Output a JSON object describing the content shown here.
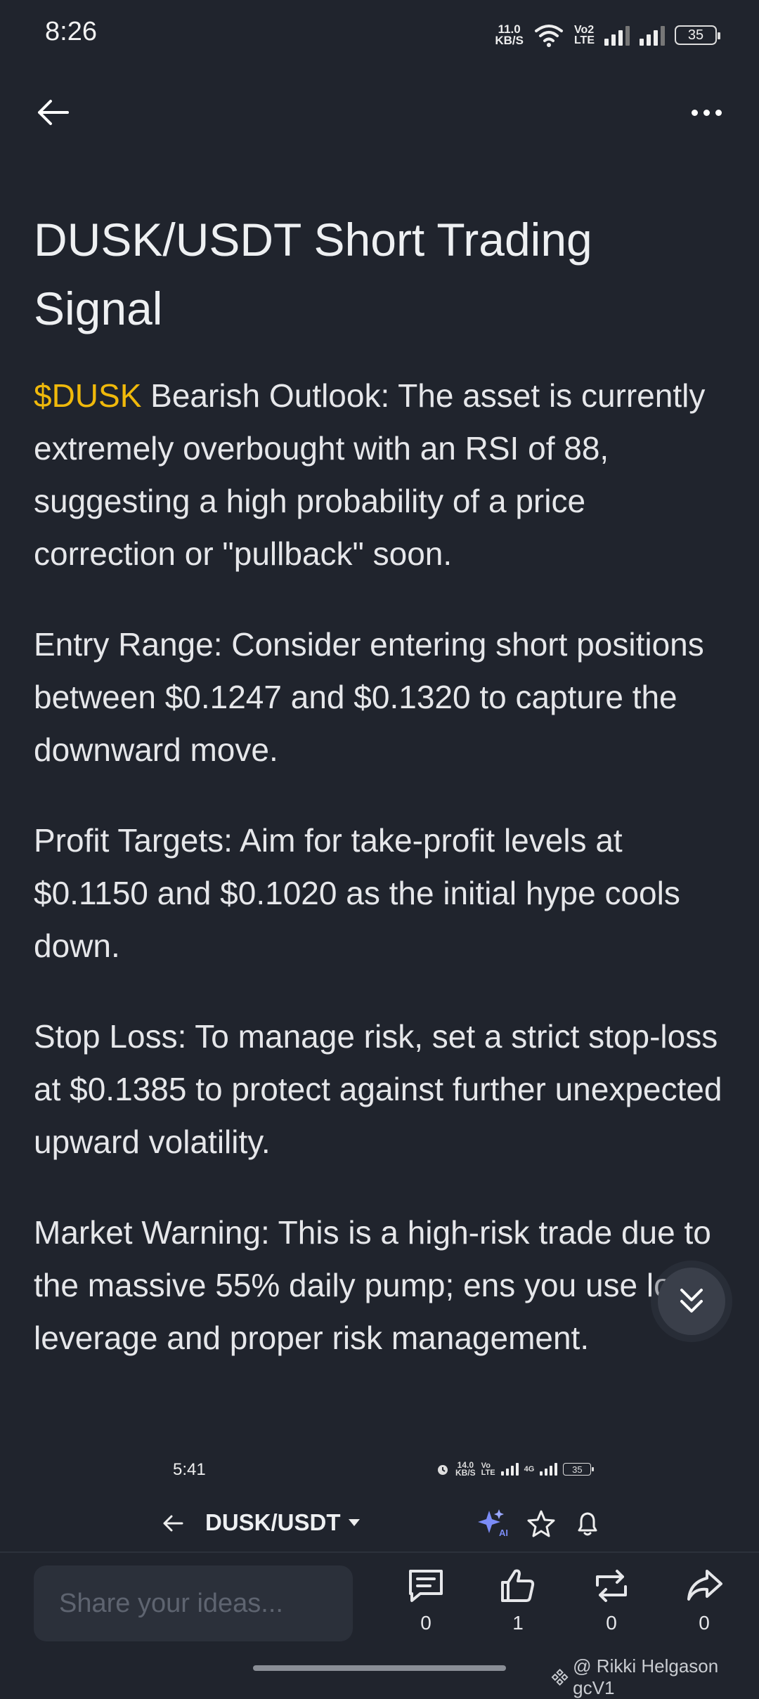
{
  "status_bar": {
    "time": "8:26",
    "net_speed_value": "11.0",
    "net_speed_unit": "KB/S",
    "volte_top": "Vo",
    "volte_bottom": "LTE",
    "volte_sim": "2",
    "battery": "35"
  },
  "header": {
    "back_icon": "arrow-left-icon",
    "more_icon": "more-horizontal-icon"
  },
  "article": {
    "title": "DUSK/USDT Short Trading Signal",
    "tag": "$DUSK",
    "paragraphs": [
      " Bearish Outlook: The asset is currently extremely overbought with an RSI of 88, suggesting a high probability of a price correction or \"pullback\" soon.",
      "Entry Range: Consider entering short positions between $0.1247 and $0.1320 to capture the downward move.",
      "Profit Targets: Aim for take-profit levels at $0.1150 and $0.1020 as the initial hype cools down.",
      "Stop Loss: To manage risk, set a strict stop-loss at $0.1385 to protect against further unexpected upward volatility.",
      "Market Warning: This is a high-risk trade due to the massive 55% daily pump; ens you use low leverage and proper risk management."
    ]
  },
  "embedded_screenshot": {
    "status_time": "5:41",
    "net_speed_value": "14.0",
    "net_speed_unit": "KB/S",
    "volte_top": "Vo",
    "volte_bottom": "LTE",
    "signal_label": "4G",
    "battery": "35",
    "pair": "DUSK/USDT"
  },
  "bottom_bar": {
    "share_placeholder": "Share your ideas...",
    "comments_count": "0",
    "likes_count": "1",
    "reposts_count": "0",
    "shares_count": "0"
  },
  "watermark": "@ Rikki Helgason gcV1",
  "colors": {
    "background": "#20242d",
    "accent": "#f0b90b",
    "text": "#e6e7ea"
  }
}
